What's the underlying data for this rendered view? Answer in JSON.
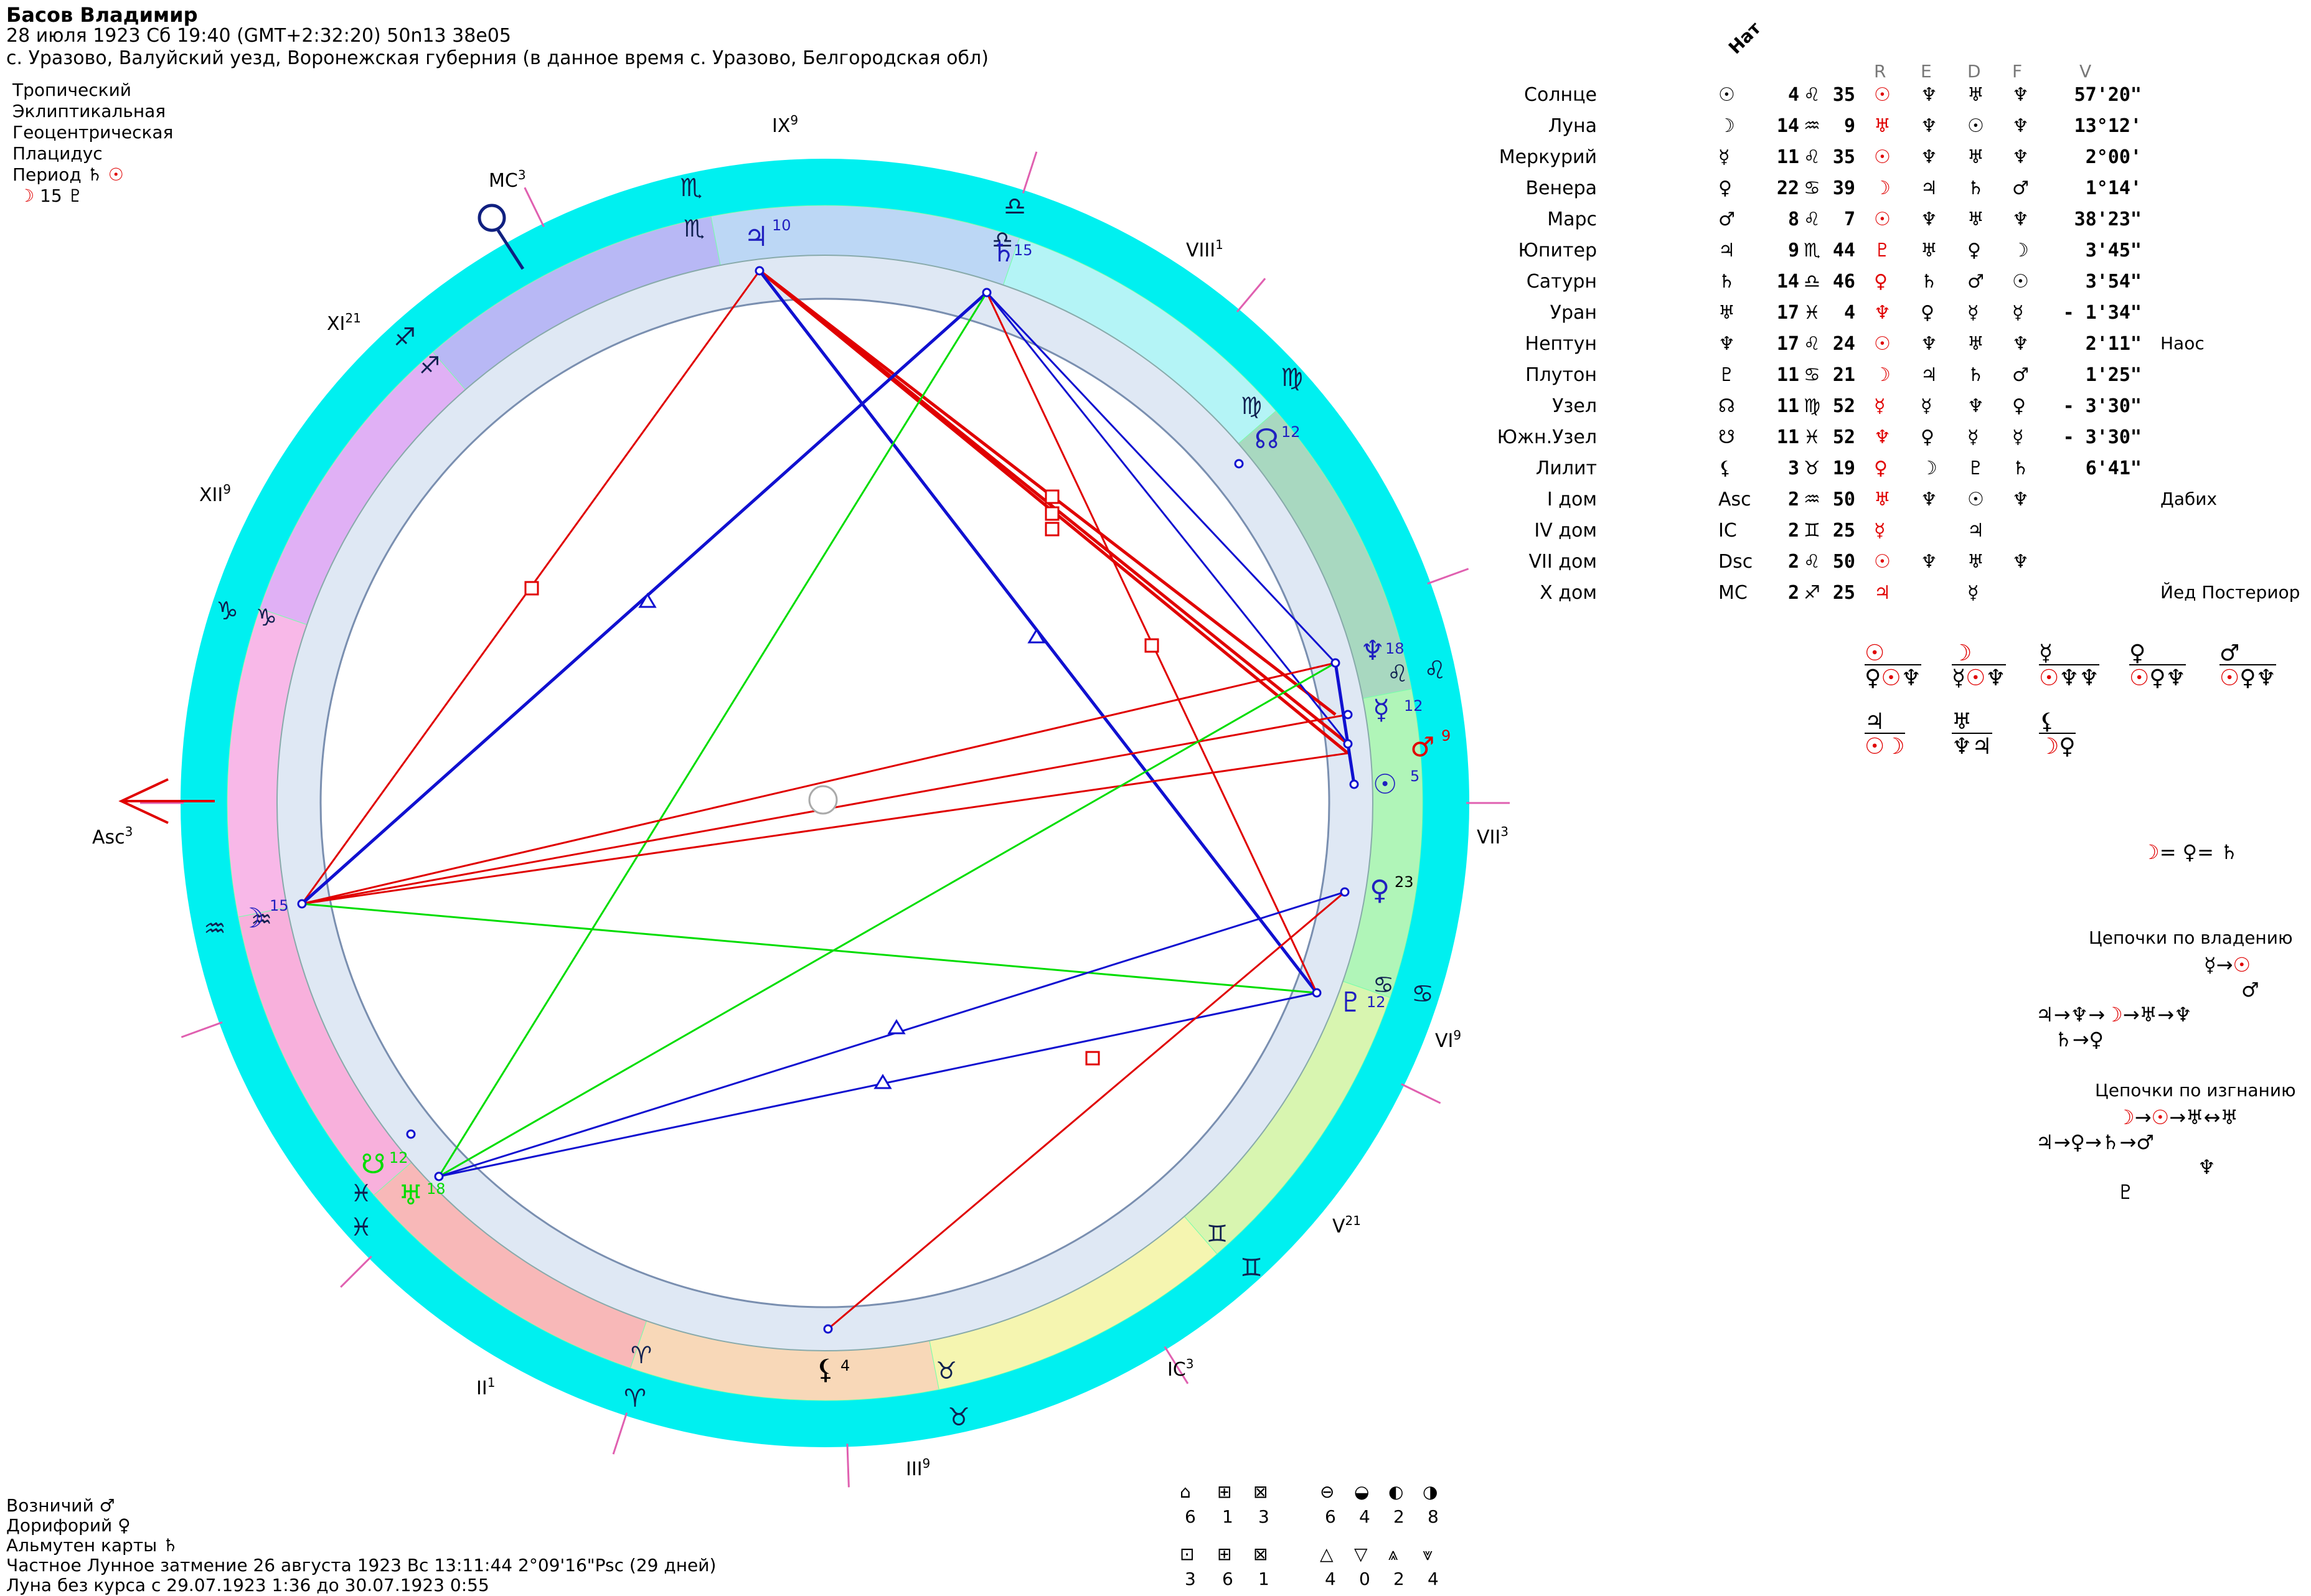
{
  "header": {
    "name": "Басов Владимир",
    "datetime": "28 июля 1923  Сб  19:40 (GMT+2:32:20) 50n13  38e05",
    "place": "с. Уразово, Валуйский уезд, Воронежская губерния (в данное время с. Уразово, Белгородская обл)",
    "settings": [
      "Тропический",
      "Эклиптикальная",
      "Геоцентрическая",
      "Плацидус"
    ],
    "period_label": "Период",
    "period_value": "15"
  },
  "footer": {
    "lines": [
      "Возничий ♂",
      "Дорифорий ♀",
      "Альмутен карты ♄",
      "Частное Лунное затмение 26 августа 1923 Вс 13:11:44  2°09'16\"Psc (29 дней)",
      "Луна без курса с 29.07.1923  1:36 до 30.07.1923  0:55"
    ]
  },
  "aspect_counts": {
    "row1a": [
      "6",
      "1",
      "3"
    ],
    "row1b": [
      "6",
      "4",
      "2",
      "8"
    ],
    "row2a": [
      "3",
      "6",
      "1"
    ],
    "row2b": [
      "4",
      "0",
      "2",
      "4"
    ]
  },
  "house_labels": {
    "asc": "Asc",
    "asc_sup": "3",
    "mc": "MC",
    "mc_sup": "3",
    "ic": "IC",
    "ic_sup": "3",
    "vii": "VII",
    "vii_sup": "3",
    "ii": "II",
    "ii_sup": "1",
    "iii": "III",
    "iii_sup": "9",
    "v": "V",
    "v_sup": "21",
    "vi": "VI",
    "vi_sup": "9",
    "viii": "VIII",
    "viii_sup": "1",
    "ix": "IX",
    "ix_sup": "9",
    "xi": "XI",
    "xi_sup": "21",
    "xii": "XII",
    "xii_sup": "9"
  },
  "planet_degrees": {
    "jupiter": "10",
    "saturn": "15",
    "node": "12",
    "neptune": "18",
    "mercury": "12",
    "mars": "9",
    "sun": "5",
    "venus": "23",
    "pluto": "12",
    "moon": "15",
    "uranus": "18",
    "south_node": "12",
    "lilith": "4"
  },
  "table": {
    "header": "Нат",
    "columns": [
      "R",
      "E",
      "D",
      "F",
      "V"
    ],
    "rows": [
      {
        "name": "Солнце",
        "glyph": "☉",
        "deg": "4",
        "sign": "♌",
        "min": "35",
        "r": "☉",
        "e": "♆",
        "d": "♅",
        "f": "♆",
        "v": "57'20\"",
        "note": ""
      },
      {
        "name": "Луна",
        "glyph": "☽",
        "deg": "14",
        "sign": "♒",
        "min": "9",
        "r": "♅",
        "e": "♆",
        "d": "☉",
        "f": "♆",
        "v": "13°12'",
        "note": ""
      },
      {
        "name": "Меркурий",
        "glyph": "☿",
        "deg": "11",
        "sign": "♌",
        "min": "35",
        "r": "☉",
        "e": "♆",
        "d": "♅",
        "f": "♆",
        "v": "2°00'",
        "note": ""
      },
      {
        "name": "Венера",
        "glyph": "♀",
        "deg": "22",
        "sign": "♋",
        "min": "39",
        "r": "☽",
        "e": "♃",
        "d": "♄",
        "f": "♂",
        "v": "1°14'",
        "note": ""
      },
      {
        "name": "Марс",
        "glyph": "♂",
        "deg": "8",
        "sign": "♌",
        "min": "7",
        "r": "☉",
        "e": "♆",
        "d": "♅",
        "f": "♆",
        "v": "38'23\"",
        "note": ""
      },
      {
        "name": "Юпитер",
        "glyph": "♃",
        "deg": "9",
        "sign": "♏",
        "min": "44",
        "r": "♇",
        "e": "♅",
        "d": "♀",
        "f": "☽",
        "v": "3'45\"",
        "note": ""
      },
      {
        "name": "Сатурн",
        "glyph": "♄",
        "deg": "14",
        "sign": "♎",
        "min": "46",
        "r": "♀",
        "e": "♄",
        "d": "♂",
        "f": "☉",
        "v": "3'54\"",
        "note": ""
      },
      {
        "name": "Уран",
        "glyph": "♅",
        "deg": "17",
        "sign": "♓",
        "min": "4",
        "r": "♆",
        "e": "♀",
        "d": "☿",
        "f": "☿",
        "v": "- 1'34\"",
        "note": ""
      },
      {
        "name": "Нептун",
        "glyph": "♆",
        "deg": "17",
        "sign": "♌",
        "min": "24",
        "r": "☉",
        "e": "♆",
        "d": "♅",
        "f": "♆",
        "v": "2'11\"",
        "note": "Наос"
      },
      {
        "name": "Плутон",
        "glyph": "♇",
        "deg": "11",
        "sign": "♋",
        "min": "21",
        "r": "☽",
        "e": "♃",
        "d": "♄",
        "f": "♂",
        "v": "1'25\"",
        "note": ""
      },
      {
        "name": "Узел",
        "glyph": "☊",
        "deg": "11",
        "sign": "♍",
        "min": "52",
        "r": "☿",
        "e": "☿",
        "d": "♆",
        "f": "♀",
        "v": "- 3'30\"",
        "note": ""
      },
      {
        "name": "Южн.Узел",
        "glyph": "☋",
        "deg": "11",
        "sign": "♓",
        "min": "52",
        "r": "♆",
        "e": "♀",
        "d": "☿",
        "f": "☿",
        "v": "- 3'30\"",
        "note": ""
      },
      {
        "name": "Лилит",
        "glyph": "⚸",
        "deg": "3",
        "sign": "♉",
        "min": "19",
        "r": "♀",
        "e": "☽",
        "d": "♇",
        "f": "♄",
        "v": "6'41\"",
        "note": ""
      },
      {
        "name": "I дом",
        "glyph": "Asc",
        "deg": "2",
        "sign": "♒",
        "min": "50",
        "r": "♅",
        "e": "♆",
        "d": "☉",
        "f": "♆",
        "v": "",
        "note": "Дабих"
      },
      {
        "name": "IV дом",
        "glyph": "IC",
        "deg": "2",
        "sign": "♊",
        "min": "25",
        "r": "☿",
        "e": "",
        "d": "♃",
        "f": "",
        "v": "",
        "note": ""
      },
      {
        "name": "VII дом",
        "glyph": "Dsc",
        "deg": "2",
        "sign": "♌",
        "min": "50",
        "r": "☉",
        "e": "♆",
        "d": "♅",
        "f": "♆",
        "v": "",
        "note": ""
      },
      {
        "name": "X дом",
        "glyph": "MC",
        "deg": "2",
        "sign": "♐",
        "min": "25",
        "r": "♃",
        "e": "",
        "d": "☿",
        "f": "",
        "v": "",
        "note": "Йед Постериор"
      }
    ]
  },
  "chains": {
    "ownership_title": "Цепочки по владению",
    "exile_title": "Цепочки по изгнанию"
  },
  "colors": {
    "outer_ring": "#00f0f0",
    "ring_inner": "#e0e8f4",
    "aspect_red": "#e00000",
    "aspect_blue": "#1010d0",
    "aspect_green": "#00dd00",
    "sign_violet": "#e0a0ff"
  }
}
